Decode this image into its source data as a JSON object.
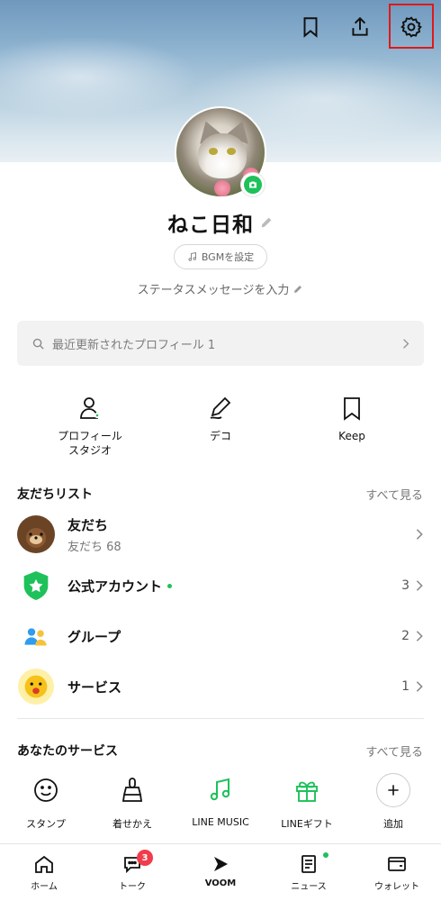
{
  "header": {
    "icons": [
      "bookmark-icon",
      "share-upload-icon",
      "settings-gear-icon"
    ]
  },
  "profile": {
    "name": "ねこ日和",
    "bgm_button": "BGMを設定",
    "status_placeholder": "ステータスメッセージを入力"
  },
  "search": {
    "label": "最近更新されたプロフィール 1"
  },
  "shortcuts": [
    {
      "label": "プロフィール\nスタジオ",
      "icon": "profile-studio-icon"
    },
    {
      "label": "デコ",
      "icon": "pen-icon"
    },
    {
      "label": "Keep",
      "icon": "bookmark-icon"
    }
  ],
  "friends_section": {
    "title": "友だちリスト",
    "see_all": "すべて見る",
    "rows": [
      {
        "title": "友だち",
        "sub": "友だち 68",
        "count": "",
        "icon": "bear-avatar-icon"
      },
      {
        "title": "公式アカウント",
        "sub": "",
        "count": "3",
        "icon": "official-shield-icon"
      },
      {
        "title": "グループ",
        "sub": "",
        "count": "2",
        "icon": "group-icon"
      },
      {
        "title": "サービス",
        "sub": "",
        "count": "1",
        "icon": "service-face-icon"
      }
    ]
  },
  "services_section": {
    "title": "あなたのサービス",
    "see_all": "すべて見る",
    "items": [
      {
        "label": "スタンプ",
        "icon": "smiley-icon"
      },
      {
        "label": "着せかえ",
        "icon": "brush-icon"
      },
      {
        "label": "LINE MUSIC",
        "icon": "music-note-icon"
      },
      {
        "label": "LINEギフト",
        "icon": "gift-icon"
      },
      {
        "label": "追加",
        "icon": "plus-icon"
      }
    ]
  },
  "tabbar": {
    "tabs": [
      {
        "label": "ホーム",
        "icon": "home-icon"
      },
      {
        "label": "トーク",
        "icon": "chat-icon",
        "badge": "3"
      },
      {
        "label": "VOOM",
        "icon": "voom-play-icon"
      },
      {
        "label": "ニュース",
        "icon": "news-icon"
      },
      {
        "label": "ウォレット",
        "icon": "wallet-icon"
      }
    ]
  },
  "colors": {
    "accent_green": "#1ec15a",
    "badge_red": "#f03c4c",
    "highlight_red": "#e01818"
  }
}
